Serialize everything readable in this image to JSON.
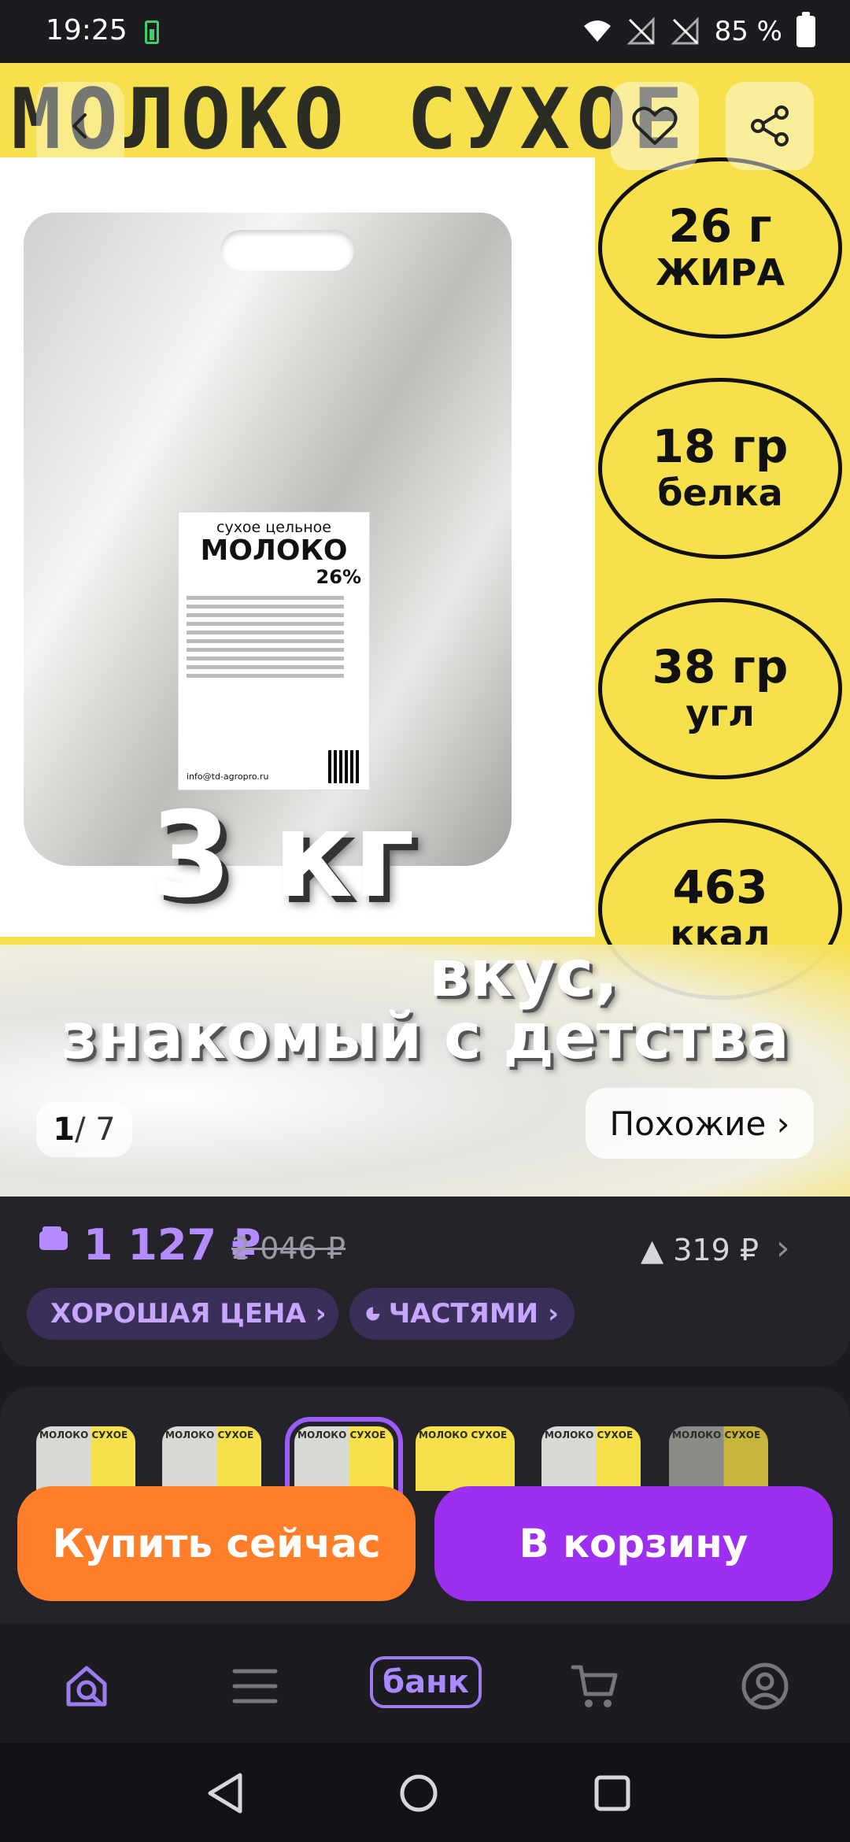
{
  "status_bar": {
    "time": "19:25",
    "battery_percent": "85 %"
  },
  "hero": {
    "title": "МОЛОКО СУХОЕ",
    "label_subtitle": "сухое цельное",
    "label_title": "МОЛОКО",
    "label_percent": "26%",
    "label_email": "info@td-agropro.ru",
    "weight": "3 кг",
    "badges": [
      {
        "line1": "26 г",
        "line2": "ЖИРА"
      },
      {
        "line1": "18 гр",
        "line2": "белка"
      },
      {
        "line1": "38 гр",
        "line2": "угл"
      },
      {
        "line1": "463",
        "line2": "ккал"
      }
    ],
    "slogan_line1": "вкус,",
    "slogan_line2": "знакомый с детства",
    "counter_current": "1",
    "counter_total": "/ 7",
    "similar_label": "Похожие ›"
  },
  "price": {
    "current": "1 127 ₽",
    "old": "2 046 ₽",
    "diff": "▲ 319 ₽",
    "chip_good_price": "ХОРОШАЯ ЦЕНА ›",
    "chip_installments": "ЧАСТЯМИ ›"
  },
  "thumbnails": [
    {
      "label": "МОЛОКО СУХОЕ"
    },
    {
      "label": "МОЛОКО СУХОЕ"
    },
    {
      "label": "МОЛОКО СУХОЕ"
    },
    {
      "label": "МОЛОКО СУХОЕ"
    },
    {
      "label": "МОЛОКО СУХОЕ"
    },
    {
      "label": "МОЛОКО СУХОЕ"
    }
  ],
  "actions": {
    "buy_now": "Купить сейчас",
    "add_to_cart": "В корзину"
  },
  "bottom_nav": {
    "bank_label": "банк",
    "items": [
      "search-home-icon",
      "catalog-menu-icon",
      "bank",
      "cart-icon",
      "profile-icon"
    ]
  },
  "colors": {
    "accent_purple": "#9d2ff0",
    "accent_orange": "#ff7e2a",
    "price_purple": "#b58cff",
    "hero_yellow": "#f6e04c"
  }
}
